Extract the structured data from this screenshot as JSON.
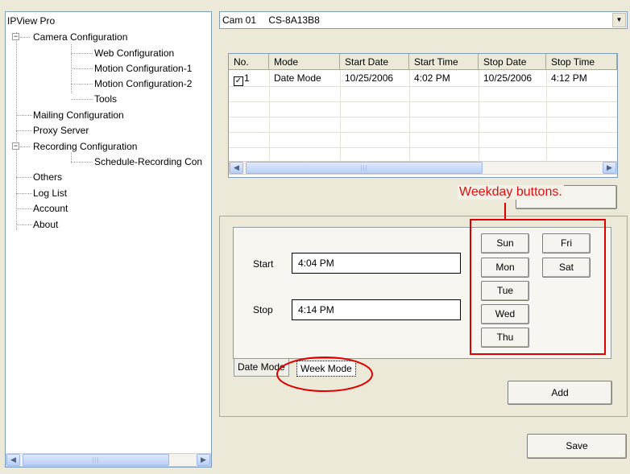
{
  "tree": {
    "root": "IPView Pro",
    "camera_configuration": "Camera Configuration",
    "web_configuration": "Web Configuration",
    "motion_configuration_1": "Motion Configuration-1",
    "motion_configuration_2": "Motion Configuration-2",
    "tools": "Tools",
    "mailing_configuration": "Mailing Configuration",
    "proxy_server": "Proxy Server",
    "recording_configuration": "Recording Configuration",
    "schedule_recording": "Schedule-Recording Con",
    "others": "Others",
    "log_list": "Log List",
    "account": "Account",
    "about": "About",
    "expander_symbol": "−"
  },
  "camera_select": {
    "camera_id": "Cam 01",
    "camera_name": "CS-8A13B8"
  },
  "schedule_table": {
    "columns": [
      "No.",
      "Mode",
      "Start Date",
      "Start Time",
      "Stop Date",
      "Stop Time"
    ],
    "rows": [
      {
        "no": "1",
        "checked": true,
        "mode": "Date Mode",
        "start_date": "10/25/2006",
        "start_time": "4:02 PM",
        "stop_date": "10/25/2006",
        "stop_time": "4:12 PM"
      }
    ]
  },
  "schedule_editor": {
    "start_label": "Start",
    "start_value": "4:04 PM",
    "stop_label": "Stop",
    "stop_value": "4:14 PM",
    "weekdays": [
      "Sun",
      "Mon",
      "Tue",
      "Wed",
      "Thu",
      "Fri",
      "Sat"
    ],
    "tabs": {
      "date_mode": "Date Mode",
      "week_mode": "Week Mode"
    },
    "active_tab": "week_mode",
    "add_label": "Add"
  },
  "save_label": "Save",
  "annotation": {
    "text": "Weekday buttons.",
    "color": "#e00000"
  },
  "colors": {
    "window_bg": "#ece9d8",
    "border_blue": "#7f9db9",
    "annotation_red": "#e00000"
  }
}
